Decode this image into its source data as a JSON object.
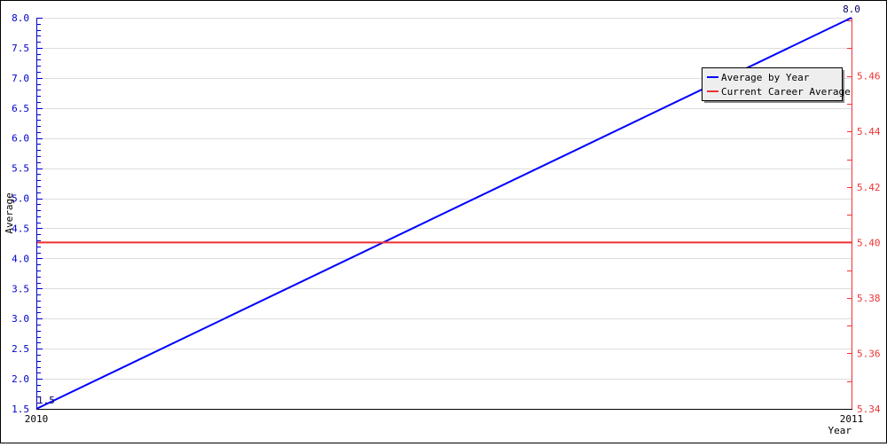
{
  "chart_data": {
    "type": "line",
    "title": "",
    "xlabel": "Year",
    "ylabel": "Average",
    "categories": [
      "2010",
      "2011"
    ],
    "x": [
      2010,
      2011
    ],
    "series": [
      {
        "name": "Average by Year",
        "axis": "left",
        "color": "#0000ff",
        "values": [
          1.5,
          8.0
        ],
        "point_labels": [
          "1.5",
          "8.0"
        ]
      },
      {
        "name": "Current Career Average",
        "axis": "right",
        "color": "#ee3333",
        "values": [
          5.4,
          5.4
        ]
      }
    ],
    "left_axis": {
      "color": "#0000cc",
      "ylim": [
        1.5,
        8.0
      ],
      "major_step": 0.5,
      "minor_step": 0.1,
      "tick_labels": [
        "1.5",
        "2.0",
        "2.5",
        "3.0",
        "3.5",
        "4.0",
        "4.5",
        "5.0",
        "5.5",
        "6.0",
        "6.5",
        "7.0",
        "7.5",
        "8.0"
      ]
    },
    "right_axis": {
      "color": "#ee3333",
      "ylim": [
        5.34,
        5.481
      ],
      "major_step": 0.02,
      "minor_step": 0.01,
      "tick_labels": [
        "5.34",
        "5.36",
        "5.38",
        "5.40",
        "5.42",
        "5.44",
        "5.46"
      ]
    },
    "grid": true,
    "legend": {
      "position": "top-right",
      "entries": [
        "Average by Year",
        "Current Career Average"
      ]
    }
  }
}
